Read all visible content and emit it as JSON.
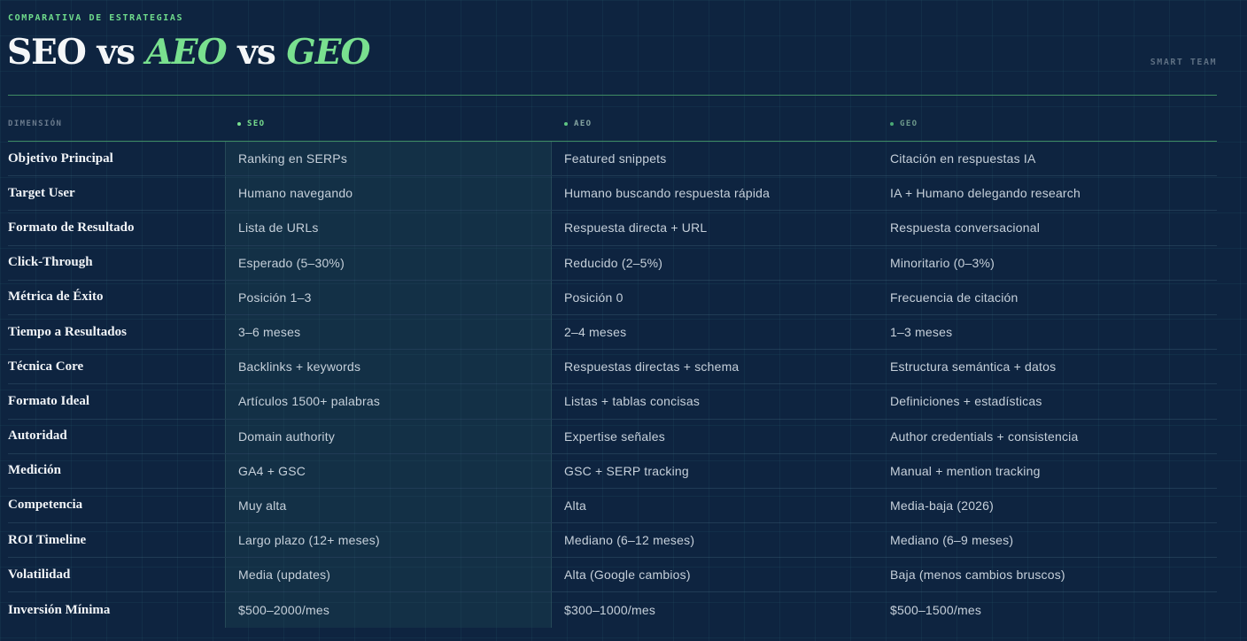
{
  "header": {
    "eyebrow": "COMPARATIVA DE ESTRATEGIAS",
    "title_part1": "SEO",
    "title_vs1": " vs ",
    "title_part2": "AEO",
    "title_vs2": " vs ",
    "title_part3": "GEO",
    "brand": "SMART TEAM"
  },
  "colors": {
    "accent": "#79e08f",
    "background": "#0e2440"
  },
  "table": {
    "columns": {
      "dimension": "DIMENSIÓN",
      "seo": "SEO",
      "aeo": "AEO",
      "geo": "GEO"
    },
    "rows": [
      {
        "dimension": "Objetivo Principal",
        "seo": "Ranking en SERPs",
        "aeo": "Featured snippets",
        "geo": "Citación en respuestas IA"
      },
      {
        "dimension": "Target User",
        "seo": "Humano navegando",
        "aeo": "Humano buscando respuesta rápida",
        "geo": "IA + Humano delegando research"
      },
      {
        "dimension": "Formato de Resultado",
        "seo": "Lista de URLs",
        "aeo": "Respuesta directa + URL",
        "geo": "Respuesta conversacional"
      },
      {
        "dimension": "Click-Through",
        "seo": "Esperado (5–30%)",
        "aeo": "Reducido (2–5%)",
        "geo": "Minoritario (0–3%)"
      },
      {
        "dimension": "Métrica de Éxito",
        "seo": "Posición 1–3",
        "aeo": "Posición 0",
        "geo": "Frecuencia de citación"
      },
      {
        "dimension": "Tiempo a Resultados",
        "seo": "3–6 meses",
        "aeo": "2–4 meses",
        "geo": "1–3 meses"
      },
      {
        "dimension": "Técnica Core",
        "seo": "Backlinks + keywords",
        "aeo": "Respuestas directas + schema",
        "geo": "Estructura semántica + datos"
      },
      {
        "dimension": "Formato Ideal",
        "seo": "Artículos 1500+ palabras",
        "aeo": "Listas + tablas concisas",
        "geo": "Definiciones + estadísticas"
      },
      {
        "dimension": "Autoridad",
        "seo": "Domain authority",
        "aeo": "Expertise señales",
        "geo": "Author credentials + consistencia"
      },
      {
        "dimension": "Medición",
        "seo": "GA4 + GSC",
        "aeo": "GSC + SERP tracking",
        "geo": "Manual + mention tracking"
      },
      {
        "dimension": "Competencia",
        "seo": "Muy alta",
        "aeo": "Alta",
        "geo": "Media-baja (2026)"
      },
      {
        "dimension": "ROI Timeline",
        "seo": "Largo plazo (12+ meses)",
        "aeo": "Mediano (6–12 meses)",
        "geo": "Mediano (6–9 meses)"
      },
      {
        "dimension": "Volatilidad",
        "seo": "Media (updates)",
        "aeo": "Alta (Google cambios)",
        "geo": "Baja (menos cambios bruscos)"
      },
      {
        "dimension": "Inversión Mínima",
        "seo": "$500–2000/mes",
        "aeo": "$300–1000/mes",
        "geo": "$500–1500/mes"
      }
    ]
  }
}
